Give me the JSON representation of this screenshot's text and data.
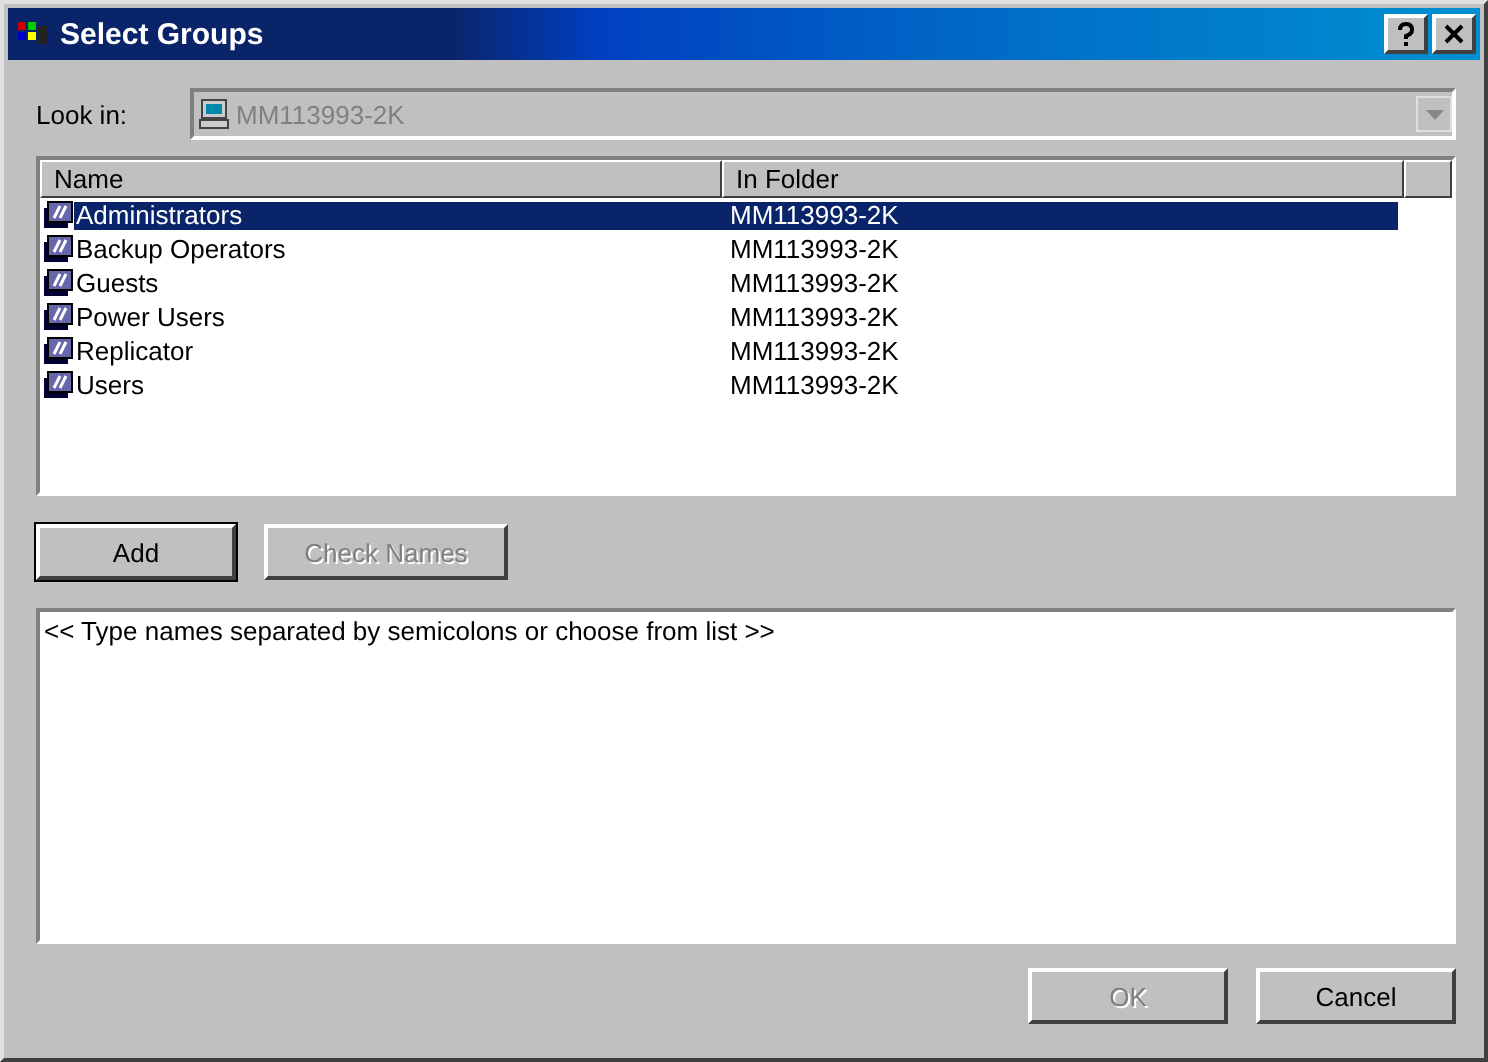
{
  "window": {
    "title": "Select Groups"
  },
  "look_in": {
    "label": "Look in:",
    "value": "MM113993-2K",
    "disabled": true
  },
  "table": {
    "columns": [
      "Name",
      "In Folder"
    ],
    "rows": [
      {
        "name": "Administrators",
        "folder": "MM113993-2K",
        "selected": true
      },
      {
        "name": "Backup Operators",
        "folder": "MM113993-2K",
        "selected": false
      },
      {
        "name": "Guests",
        "folder": "MM113993-2K",
        "selected": false
      },
      {
        "name": "Power Users",
        "folder": "MM113993-2K",
        "selected": false
      },
      {
        "name": "Replicator",
        "folder": "MM113993-2K",
        "selected": false
      },
      {
        "name": "Users",
        "folder": "MM113993-2K",
        "selected": false
      }
    ]
  },
  "list_buttons": [
    {
      "label": "Add",
      "disabled": false
    },
    {
      "label": "Check Names",
      "disabled": true
    }
  ],
  "names_field": {
    "value": "<< Type names separated by semicolons or choose from list >>"
  },
  "buttons": [
    {
      "label": "OK",
      "disabled": true
    },
    {
      "label": "Cancel",
      "disabled": false
    }
  ]
}
